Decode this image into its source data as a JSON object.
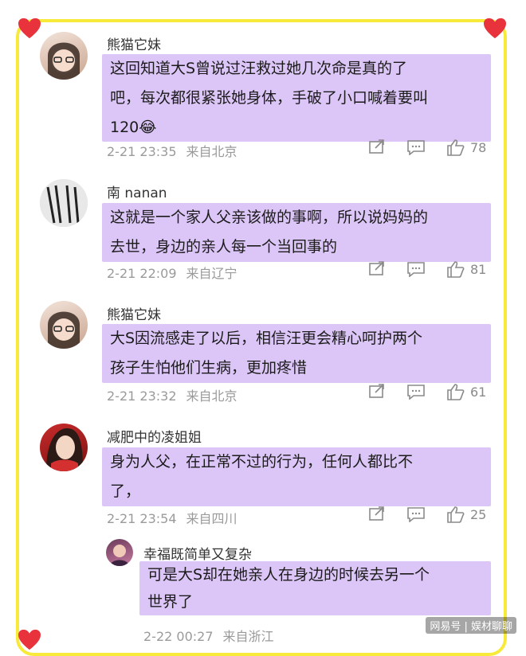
{
  "comments": [
    {
      "username": "熊猫它妹",
      "text": "这回知道大S曾说过汪救过她几次命是真的了\n吧，每次都很紧张她身体，手破了小口喊着要叫\n120😂",
      "date": "2-21 23:35",
      "location": "来自北京",
      "likes": "78"
    },
    {
      "username": "南 nanan",
      "text": "这就是一个家人父亲该做的事啊，所以说妈妈的\n去世，身边的亲人每一个当回事的",
      "date": "2-21 22:09",
      "location": "来自辽宁",
      "likes": "81"
    },
    {
      "username": "熊猫它妹",
      "text": "大S因流感走了以后，相信汪更会精心呵护两个\n孩子生怕他们生病，更加疼惜",
      "date": "2-21 23:32",
      "location": "来自北京",
      "likes": "61"
    },
    {
      "username": "减肥中的凌姐姐",
      "text": "身为人父，在正常不过的行为，任何人都比不\n了，",
      "date": "2-21 23:54",
      "location": "来自四川",
      "likes": "25"
    }
  ],
  "reply": {
    "username": "幸福既简单又复杂",
    "text": "可是大S却在她亲人在身边的时候去另一个\n世界了",
    "date": "2-22 00:27",
    "location": "来自浙江"
  },
  "watermark": "网易号 | 娱材聊聊",
  "colors": {
    "bubble": "#dcc6f7",
    "frame": "#f7ea3a",
    "heart": "#e8323c"
  }
}
